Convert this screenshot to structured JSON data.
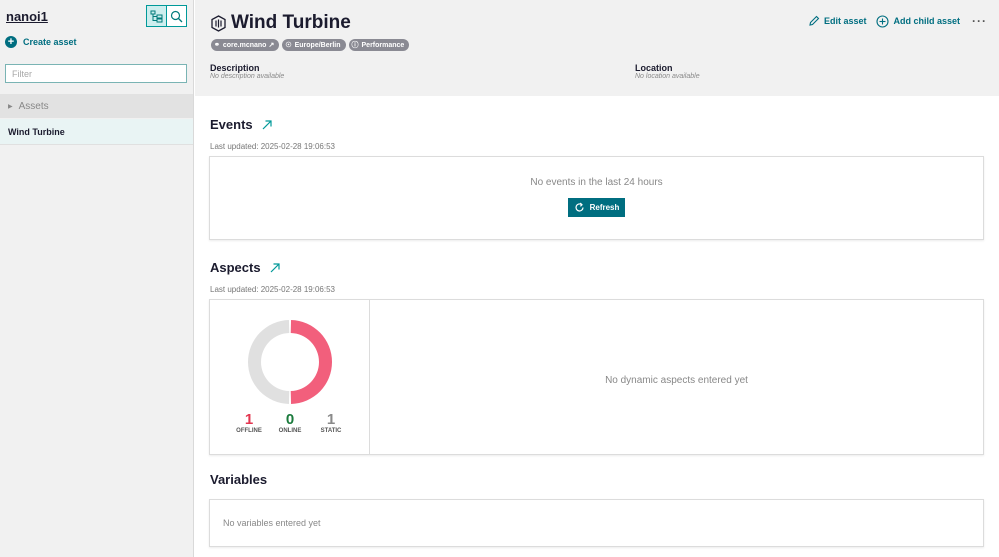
{
  "sidebar": {
    "tenant": "nanoi1",
    "create_asset_label": "Create asset",
    "filter_placeholder": "Filter",
    "tree_root_label": "Assets",
    "selected_item": "Wind Turbine"
  },
  "header": {
    "title": "Wind Turbine",
    "chips": [
      {
        "icon": "link-icon",
        "label": "core.mcnano"
      },
      {
        "icon": "globe-icon",
        "label": "Europe/Berlin"
      },
      {
        "icon": "gauge-icon",
        "label": "Performance"
      }
    ],
    "description_label": "Description",
    "description_value": "No description available",
    "location_label": "Location",
    "location_value": "No location available",
    "edit_label": "Edit asset",
    "add_child_label": "Add child asset",
    "more_label": "···"
  },
  "events": {
    "title": "Events",
    "updated": "Last updated: 2025-02-28 19:06:53",
    "empty": "No events in the last 24 hours",
    "refresh_label": "Refresh"
  },
  "aspects": {
    "title": "Aspects",
    "updated": "Last updated: 2025-02-28 19:06:53",
    "empty": "No dynamic aspects entered yet",
    "stats": [
      {
        "value": "1",
        "label": "OFFLINE",
        "color": "#e3354f"
      },
      {
        "value": "0",
        "label": "ONLINE",
        "color": "#1a7a3c"
      },
      {
        "value": "1",
        "label": "STATIC",
        "color": "#8a8a8a"
      }
    ],
    "donut": {
      "offline": 1,
      "online": 0,
      "static": 1,
      "offline_color": "#f25f7c",
      "static_color": "#e0e0e0"
    }
  },
  "variables": {
    "title": "Variables",
    "empty": "No variables entered yet"
  },
  "colors": {
    "accent": "#006e80",
    "brand_border": "#009999"
  }
}
